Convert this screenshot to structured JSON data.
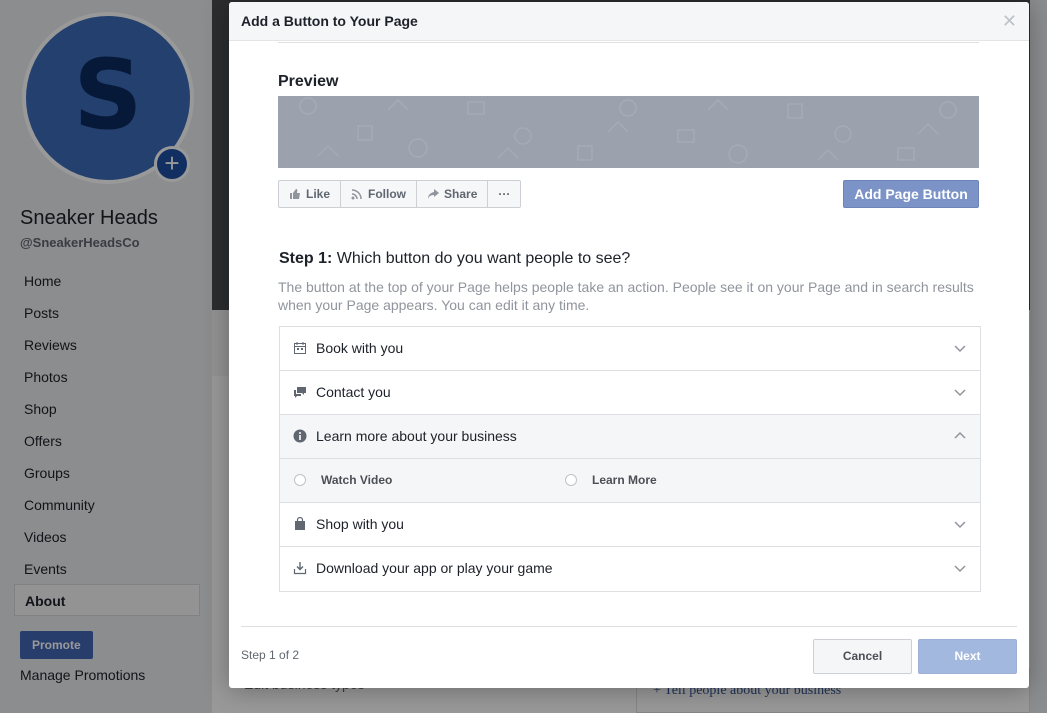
{
  "background_page": {
    "avatar_letter": "S",
    "page_name": "Sneaker Heads",
    "page_handle": "@SneakerHeadsCo",
    "nav": [
      {
        "label": "Home"
      },
      {
        "label": "Posts"
      },
      {
        "label": "Reviews"
      },
      {
        "label": "Photos"
      },
      {
        "label": "Shop"
      },
      {
        "label": "Offers"
      },
      {
        "label": "Groups"
      },
      {
        "label": "Community"
      },
      {
        "label": "Videos"
      },
      {
        "label": "Events"
      },
      {
        "label": "About"
      }
    ],
    "active_nav": "About",
    "promote_label": "Promote",
    "manage_promotions": "Manage Promotions",
    "edit_business_types": "Edit business types",
    "tell_people": "+ Tell people about your business"
  },
  "modal": {
    "title": "Add a Button to Your Page",
    "close_icon": "close-icon",
    "preview_label": "Preview",
    "action_bar": {
      "like": "Like",
      "follow": "Follow",
      "share": "Share",
      "more": "···"
    },
    "add_page_button": "Add Page Button",
    "step_label": "Step 1:",
    "step_question": " Which button do you want people to see?",
    "step_description": "The button at the top of your Page helps people take an action. People see it on your Page and in search results when your Page appears. You can edit it any time.",
    "options": {
      "book": "Book with you",
      "contact": "Contact you",
      "learn": "Learn more about your business",
      "shop": "Shop with you",
      "download": "Download your app or play your game"
    },
    "learn_sub_options": {
      "watch_video": "Watch Video",
      "learn_more": "Learn More"
    },
    "step_count": "Step 1 of 2",
    "cancel_label": "Cancel",
    "next_label": "Next"
  },
  "colors": {
    "brand_blue": "#4267b2",
    "add_button": "#7c93c8",
    "next_disabled": "#a3b8df"
  }
}
